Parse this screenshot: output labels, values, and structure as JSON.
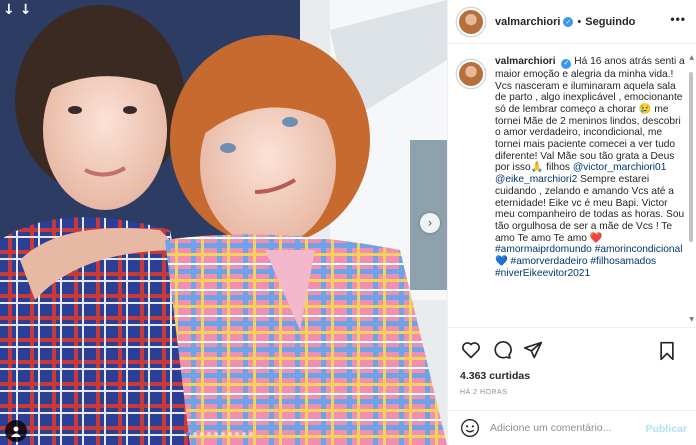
{
  "post": {
    "username": "valmarchiori",
    "separator": "•",
    "follow_label": "Seguindo",
    "more_label": "•••",
    "caption": {
      "text_1": "Há 16 anos atrás senti a maior emoção e alegria da minha vida.! Vcs nasceram e iluminaram aquela sala de parto , algo inexplicável , emocionante só de lembrar começo a chorar 😢 me tornei Mãe de 2 meninos lindos, descobri o amor verdadeiro, incondicional, me tornei mais paciente comecei a ver tudo diferente! Val Mãe sou tão grata a Deus por isso🙏 filhos ",
      "mention_1": "@victor_marchiori01",
      "mention_2": "@eike_marchiori2",
      "text_2": " Sempre estarei cuidando , zelando e amando Vcs até a eternidade! Eike vc é meu Bapi. Victor meu companheiro de todas as horas. Sou tão orgulhosa de ser a mãe de Vcs ! Te amo Te amo Te amo ",
      "heart_1": "❤️",
      "hashtag_1": "#amormaiprdomundo",
      "hashtag_2": "#amorincondicional",
      "heart_2": "💙",
      "hashtag_3": "#amorverdadeiro",
      "hashtag_4": "#filhosamados",
      "hashtag_5": "#niverEikeevitor2021"
    },
    "likes": "4.363 curtidas",
    "time": "HÁ 2 HORAS",
    "comment_placeholder": "Adicione um comentário...",
    "publish_label": "Publicar"
  },
  "media": {
    "download_icons": [
      "↓",
      "↓"
    ],
    "next_icon": "›",
    "carousel_dots": 10,
    "active_dot": 0
  },
  "icons": {
    "like": "heart-icon",
    "comment": "comment-icon",
    "share": "share-icon",
    "save": "bookmark-icon",
    "emoji": "smile-icon",
    "tag": "user-tag-icon",
    "verified": "verified-badge-icon"
  },
  "colors": {
    "link": "#00376b",
    "verified": "#3897f0",
    "publish": "#b2dffc",
    "muted": "#8e8e8e"
  }
}
